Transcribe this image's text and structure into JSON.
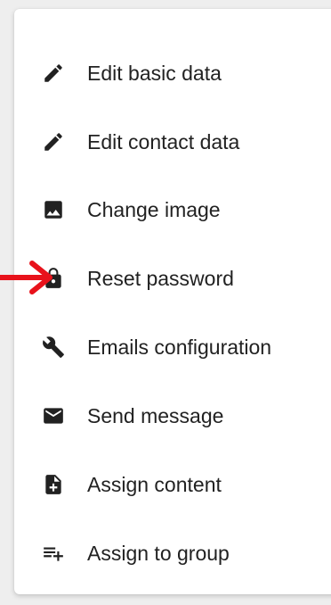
{
  "menu": {
    "items": [
      {
        "label": "Edit basic data",
        "icon": "pencil-icon"
      },
      {
        "label": "Edit contact data",
        "icon": "pencil-icon"
      },
      {
        "label": "Change image",
        "icon": "image-icon"
      },
      {
        "label": "Reset password",
        "icon": "lock-icon"
      },
      {
        "label": "Emails configuration",
        "icon": "wrench-icon"
      },
      {
        "label": "Send message",
        "icon": "mail-icon"
      },
      {
        "label": "Assign content",
        "icon": "add-file-icon"
      },
      {
        "label": "Assign to group",
        "icon": "playlist-add-icon"
      }
    ]
  },
  "annotation": {
    "icon": "red-arrow-icon",
    "color": "#e8121b",
    "points_to": "Reset password"
  },
  "colors": {
    "icon": "#212121",
    "text": "#222222",
    "background": "#ffffff"
  }
}
